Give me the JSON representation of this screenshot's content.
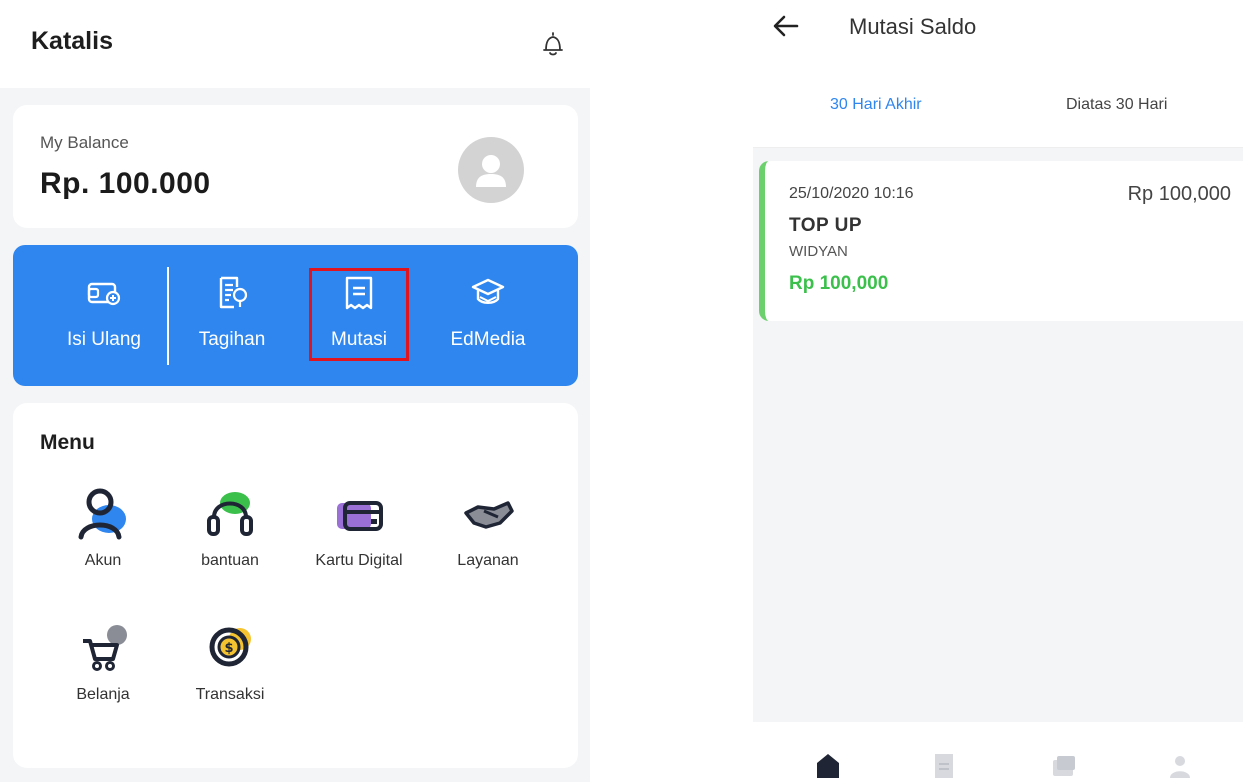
{
  "left_screen": {
    "app_title": "Katalis",
    "balance": {
      "label": "My Balance",
      "value": "Rp. 100.000"
    },
    "actions": [
      {
        "label": "Isi Ulang",
        "icon": "wallet-icon"
      },
      {
        "label": "Tagihan",
        "icon": "bill-icon"
      },
      {
        "label": "Mutasi",
        "icon": "receipt-icon",
        "highlighted": true
      },
      {
        "label": "EdMedia",
        "icon": "graduation-cap-icon"
      }
    ],
    "menu": {
      "title": "Menu",
      "items": [
        {
          "label": "Akun",
          "icon": "user-icon"
        },
        {
          "label": "bantuan",
          "icon": "headset-icon"
        },
        {
          "label": "Kartu Digital",
          "icon": "card-icon"
        },
        {
          "label": "Layanan",
          "icon": "handshake-icon"
        },
        {
          "label": "Belanja",
          "icon": "cart-icon"
        },
        {
          "label": "Transaksi",
          "icon": "coin-icon"
        }
      ]
    }
  },
  "right_screen": {
    "title": "Mutasi Saldo",
    "tabs": [
      {
        "label": "30 Hari Akhir",
        "active": true
      },
      {
        "label": "Diatas 30 Hari",
        "active": false
      }
    ],
    "transactions": [
      {
        "datetime": "25/10/2020 10:16",
        "amount_top": "Rp 100,000",
        "type": "TOP UP",
        "name": "WIDYAN",
        "amount": "Rp 100,000"
      }
    ],
    "bottom_nav": [
      "home-icon",
      "document-icon",
      "chat-icon",
      "profile-icon"
    ]
  },
  "colors": {
    "primary": "#2f86ee",
    "highlight_border": "#e0141e",
    "success": "#3cc04c",
    "card_accent": "#6cd16c"
  }
}
